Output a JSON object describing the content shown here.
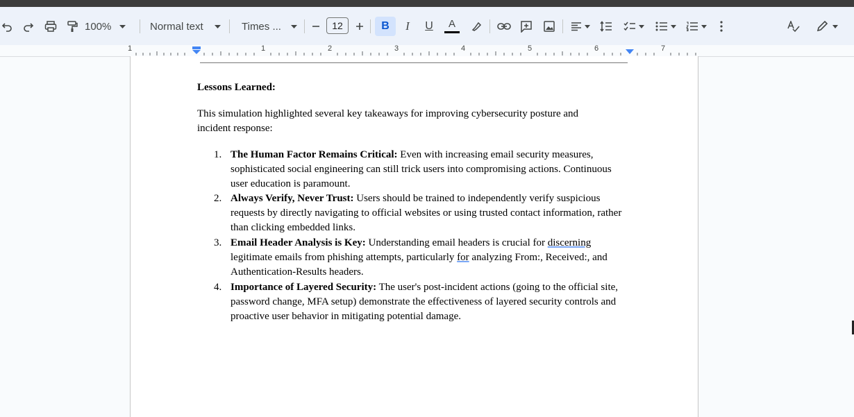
{
  "toolbar": {
    "zoom": "100%",
    "style": "Normal text",
    "font": "Times ...",
    "font_size": "12",
    "bold": "B",
    "italic": "I",
    "underline": "U",
    "text_color_letter": "A"
  },
  "ruler": {
    "numbers": [
      "1",
      "1",
      "2",
      "3",
      "4",
      "5",
      "6",
      "7"
    ]
  },
  "document": {
    "heading": "Lessons Learned:",
    "intro": "This simulation highlighted several key takeaways for improving cybersecurity posture and incident response:",
    "items": [
      {
        "number": "1.",
        "title": "The Human Factor Remains Critical:",
        "text": " Even with increasing email security measures, sophisticated social engineering can still trick users into compromising actions. Continuous user education is paramount."
      },
      {
        "number": "2.",
        "title": "Always Verify, Never Trust:",
        "text": " Users should be trained to independently verify suspicious requests by directly navigating to official websites or using trusted contact information, rather than clicking embedded links."
      },
      {
        "number": "3.",
        "title": "Email Header Analysis is Key:",
        "text_a": " Understanding email headers is crucial for ",
        "squig_a": "discerning",
        "text_b": " legitimate emails from phishing attempts, particularly ",
        "squig_b": "for",
        "text_c": " analyzing From:, Received:, and Authentication-Results headers."
      },
      {
        "number": "4.",
        "title": "Importance of Layered Security:",
        "text": " The user's post-incident actions (going to the official site, password change, MFA setup) demonstrate the effectiveness of layered security controls and proactive user behavior in mitigating potential damage."
      }
    ]
  }
}
